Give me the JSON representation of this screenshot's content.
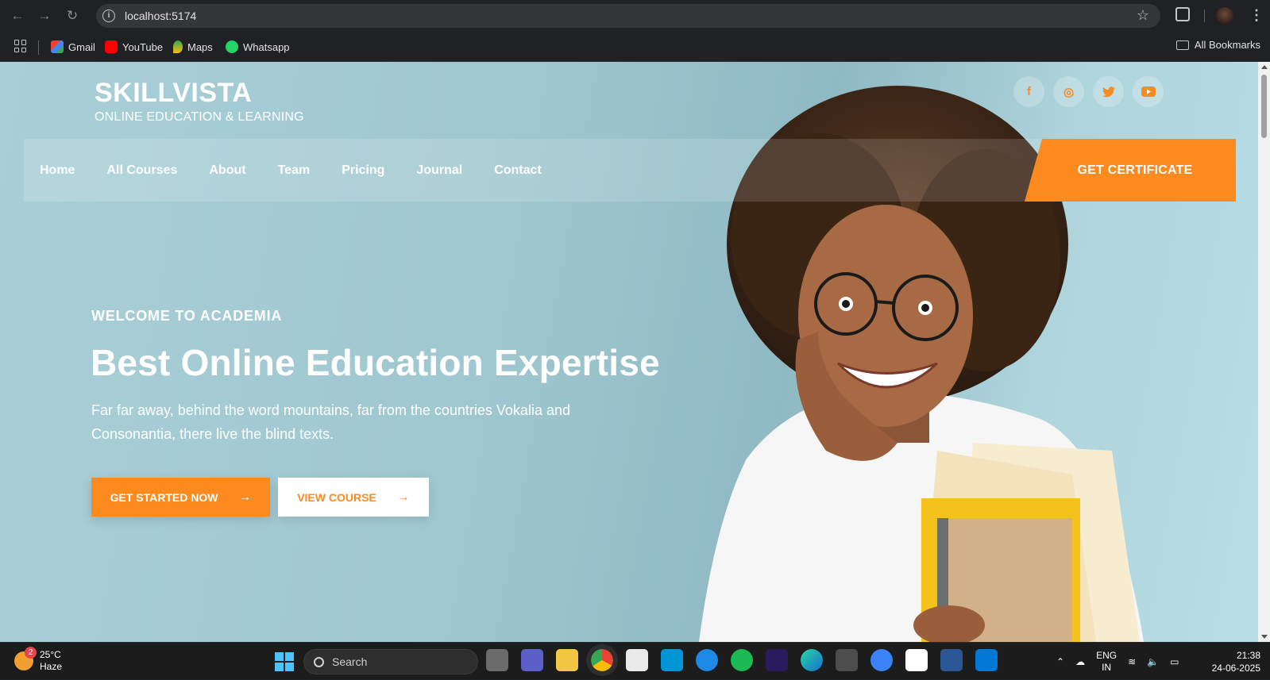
{
  "browser": {
    "url": "localhost:5174",
    "bookmarks": [
      {
        "label": "Gmail",
        "icon": "gmail-icon"
      },
      {
        "label": "YouTube",
        "icon": "youtube-icon"
      },
      {
        "label": "Maps",
        "icon": "maps-icon"
      },
      {
        "label": "Whatsapp",
        "icon": "whatsapp-icon"
      }
    ],
    "all_bookmarks": "All Bookmarks"
  },
  "site": {
    "brand": "SKILLVISTA",
    "tagline": "ONLINE EDUCATION & LEARNING",
    "socials": [
      {
        "icon": "facebook-icon",
        "glyph": "f"
      },
      {
        "icon": "instagram-icon",
        "glyph": "◎"
      },
      {
        "icon": "twitter-icon",
        "glyph": "🐦"
      },
      {
        "icon": "youtube-icon",
        "glyph": "▶"
      }
    ],
    "nav": [
      "Home",
      "All Courses",
      "About",
      "Team",
      "Pricing",
      "Journal",
      "Contact"
    ],
    "cta": "GET CERTIFICATE"
  },
  "hero": {
    "eyebrow": "WELCOME TO ACADEMIA",
    "title": "Best Online Education Expertise",
    "text": "Far far away, behind the word mountains, far from the countries Vokalia and Consonantia, there live the blind texts.",
    "primary_button": "GET STARTED NOW",
    "secondary_button": "VIEW COURSE",
    "arrow": "→"
  },
  "taskbar": {
    "weather_temp": "25°C",
    "weather_desc": "Haze",
    "weather_badge": "2",
    "search": "Search",
    "lang_top": "ENG",
    "lang_bottom": "IN",
    "time": "21:38",
    "date": "24-06-2025"
  },
  "colors": {
    "accent": "#fd8a1e",
    "hero_bg": "#a9cfd7"
  }
}
